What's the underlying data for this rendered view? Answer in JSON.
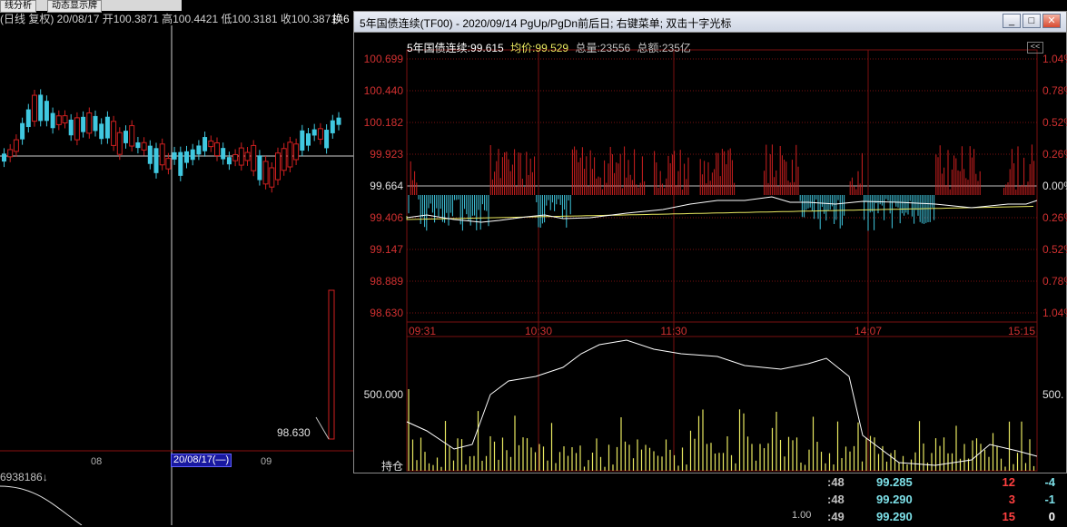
{
  "background": {
    "tabs": [
      "线分析",
      "动态显示牌"
    ],
    "header_text": "(日线 复权) 20/08/17 开100.3871 高100.4421 低100.3181 收100.3871",
    "header_right": "换6",
    "date_labels": [
      "08",
      "09"
    ],
    "cursor_date": "20/08/17(—)",
    "price_label": "98.630",
    "bottom_left_value": "6938186↓",
    "scale_value": "1.00",
    "ticks": [
      {
        "time": ":48",
        "price": "99.285",
        "vol": "12",
        "chg": "-4"
      },
      {
        "time": ":48",
        "price": "99.290",
        "vol": "3",
        "chg": "-1"
      },
      {
        "time": ":49",
        "price": "99.290",
        "vol": "15",
        "chg": "0"
      }
    ]
  },
  "popup": {
    "title": "5年国债连续(TF00) - 2020/09/14 PgUp/PgDn前后日; 右键菜单; 双击十字光标",
    "buttons": {
      "minimize": "_",
      "maximize": "□",
      "close": "✕"
    },
    "info": {
      "name_label": "5年国债连续:",
      "name_value": "99.615",
      "avg_label": "均价:",
      "avg_value": "99.529",
      "total_vol_label": "总量:",
      "total_vol_value": "23556",
      "amount_label": "总额:",
      "amount_value": "235亿"
    },
    "collapse_label": "<<",
    "price_axis": [
      "100.699",
      "100.440",
      "100.182",
      "99.923",
      "99.664",
      "99.406",
      "99.147",
      "98.889",
      "98.630"
    ],
    "pct_axis": [
      "1.04%",
      "0.78%",
      "0.52%",
      "0.26%",
      "0.00%",
      "0.26%",
      "0.52%",
      "0.78%",
      "1.04%"
    ],
    "time_axis": [
      "09:31",
      "10:30",
      "11:30",
      "14:07",
      "15:15"
    ],
    "vol_axis_left": "500.000",
    "vol_axis_right": "500.",
    "hold_label": "持仓"
  },
  "colors": {
    "up": "#d02020",
    "down": "#40c8e0",
    "avg_line": "#e8e860",
    "price_line": "#ffffff",
    "grid": "#7a1010",
    "axis_red": "#d03030",
    "volume": "#e8e860"
  }
}
